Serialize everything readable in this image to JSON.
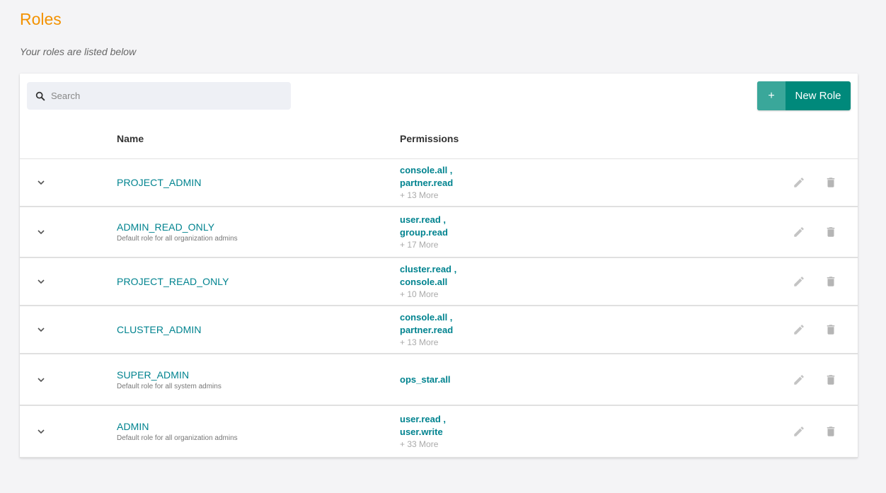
{
  "page": {
    "title": "Roles",
    "subtitle": "Your roles are listed below"
  },
  "search": {
    "placeholder": "Search",
    "value": ""
  },
  "toolbar": {
    "new_role_plus": "+",
    "new_role_label": "New Role"
  },
  "table": {
    "columns": [
      "Name",
      "Permissions"
    ],
    "rows": [
      {
        "name": "PROJECT_ADMIN",
        "description": "",
        "perm1": "console.all ,",
        "perm2": "partner.read",
        "more": "+ 13 More"
      },
      {
        "name": "ADMIN_READ_ONLY",
        "description": "Default role for all organization admins",
        "perm1": "user.read ,",
        "perm2": "group.read",
        "more": "+ 17 More"
      },
      {
        "name": "PROJECT_READ_ONLY",
        "description": "",
        "perm1": "cluster.read ,",
        "perm2": "console.all",
        "more": "+ 10 More"
      },
      {
        "name": "CLUSTER_ADMIN",
        "description": "",
        "perm1": "console.all ,",
        "perm2": "partner.read",
        "more": "+ 13 More"
      },
      {
        "name": "SUPER_ADMIN",
        "description": "Default role for all system admins",
        "perm1": "ops_star.all",
        "perm2": "",
        "more": ""
      },
      {
        "name": "ADMIN",
        "description": "Default role for all organization admins",
        "perm1": "user.read ,",
        "perm2": "user.write",
        "more": "+ 33 More"
      }
    ]
  },
  "icons": {
    "search": "search-icon",
    "expand": "chevron-down-icon",
    "edit": "pencil-icon",
    "delete": "trash-icon"
  },
  "colors": {
    "title": "#f39200",
    "accent": "#00838f",
    "button": "#00897b"
  }
}
